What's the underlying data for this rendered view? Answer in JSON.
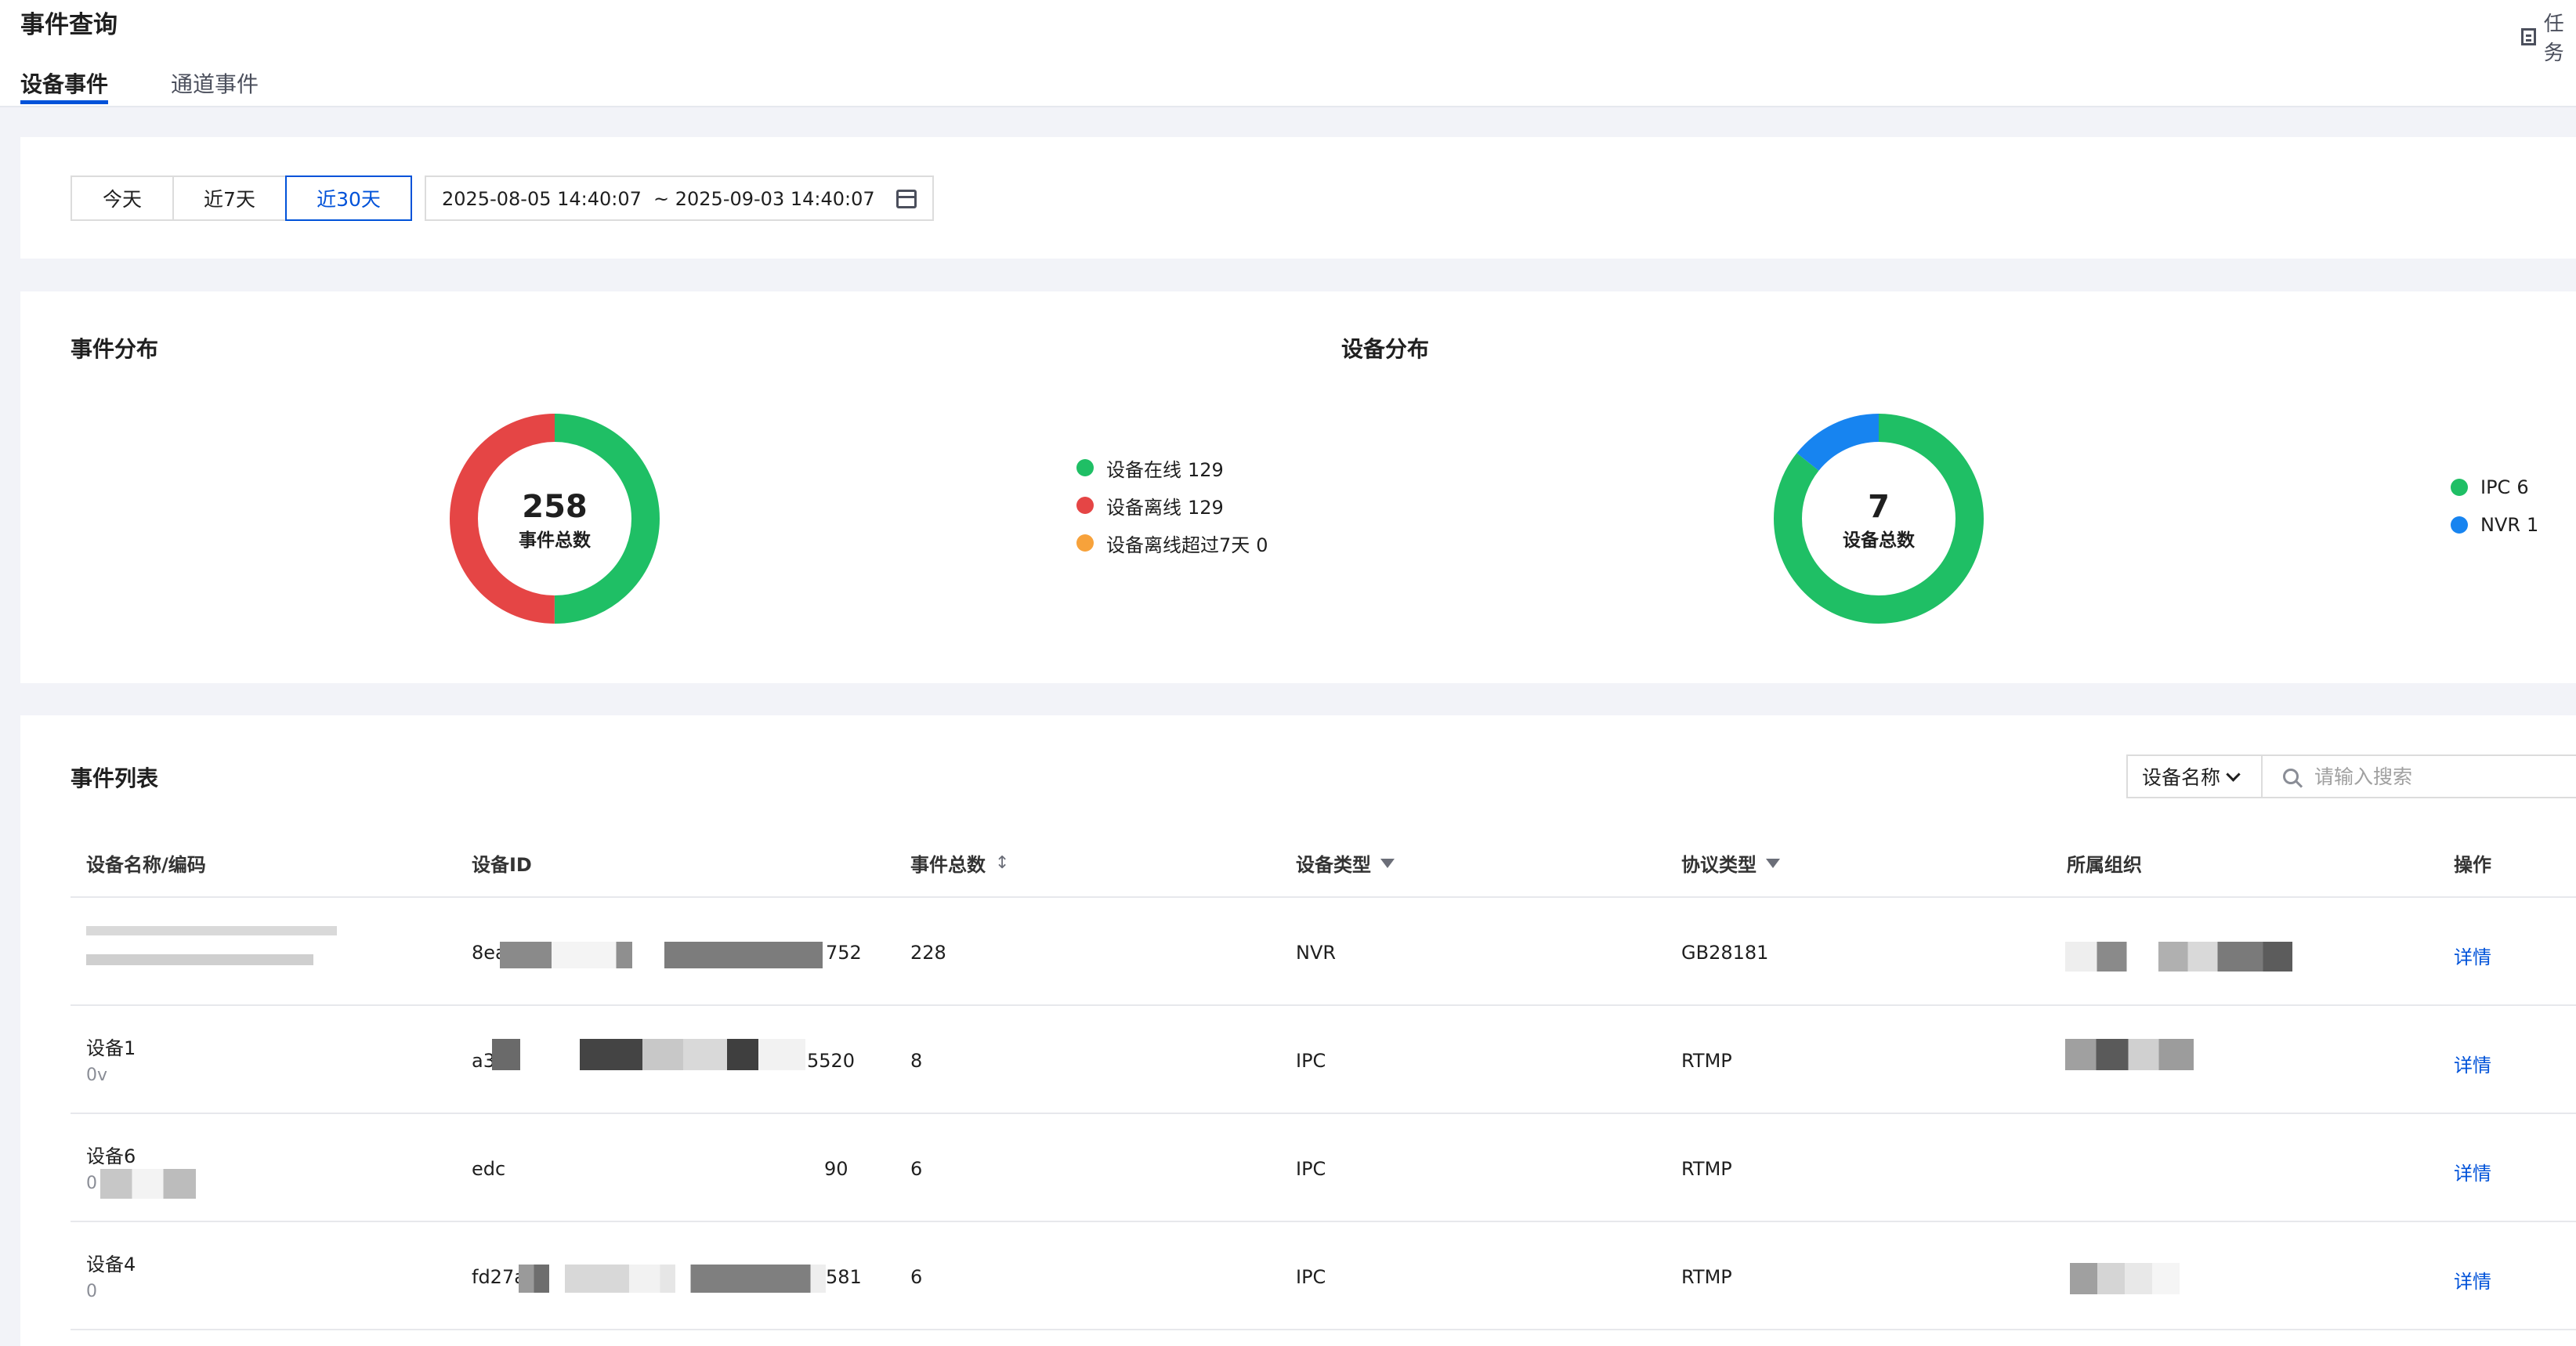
{
  "header": {
    "title": "事件查询",
    "tasks_label": "任务"
  },
  "tabs": [
    {
      "label": "设备事件"
    },
    {
      "label": "通道事件"
    }
  ],
  "filter": {
    "quick_ranges": [
      "今天",
      "近7天",
      "近30天"
    ],
    "selected_range": "近30天",
    "start": "2025-08-05 14:40:07",
    "end": "~ 2025-09-03 14:40:07"
  },
  "event_dist": {
    "title": "事件分布",
    "total": "258",
    "total_label": "事件总数",
    "items": [
      {
        "label": "设备在线",
        "value": "129",
        "color": "#1fbf65"
      },
      {
        "label": "设备离线",
        "value": "129",
        "color": "#e54545"
      },
      {
        "label": "设备离线超过7天",
        "value": "0",
        "color": "#f7a23b"
      }
    ]
  },
  "device_dist": {
    "title": "设备分布",
    "total": "7",
    "total_label": "设备总数",
    "items": [
      {
        "label": "IPC",
        "value": "6",
        "color": "#1fbf65"
      },
      {
        "label": "NVR",
        "value": "1",
        "color": "#1784f0"
      }
    ]
  },
  "event_list": {
    "title": "事件列表",
    "search_field": "设备名称",
    "search_placeholder": "请输入搜索",
    "columns": [
      "设备名称/编码",
      "设备ID",
      "事件总数",
      "设备类型",
      "协议类型",
      "所属组织",
      "操作"
    ],
    "rows": [
      {
        "name": "",
        "code": "",
        "id_prefix": "8ea",
        "id_suffix": "752",
        "total": "228",
        "type": "NVR",
        "protocol": "GB28181",
        "action": "详情"
      },
      {
        "name": "设备1",
        "code": "0v",
        "id_prefix": "a3",
        "id_suffix": "5520",
        "total": "8",
        "type": "IPC",
        "protocol": "RTMP",
        "action": "详情"
      },
      {
        "name": "设备6",
        "code": "0",
        "id_prefix": "edc",
        "id_suffix": "90",
        "total": "6",
        "type": "IPC",
        "protocol": "RTMP",
        "action": "详情"
      },
      {
        "name": "设备4",
        "code": "0",
        "id_prefix": "fd27a",
        "id_suffix": "581",
        "total": "6",
        "type": "IPC",
        "protocol": "RTMP",
        "action": "详情"
      }
    ]
  }
}
